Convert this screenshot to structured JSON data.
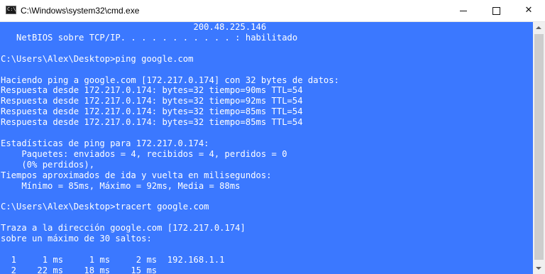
{
  "window": {
    "title": "C:\\Windows\\system32\\cmd.exe",
    "icon": "cmd-icon",
    "icon_prompt": "C:\\",
    "controls": {
      "minimize_icon": "minimize-icon",
      "maximize_icon": "maximize-icon",
      "close_label": "✕"
    }
  },
  "console": {
    "background": "#3b78ff",
    "text_color": "#ffffff",
    "lines": [
      "                                     200.48.225.146",
      "   NetBIOS sobre TCP/IP. . . . . . . . . . . : habilitado",
      "",
      "C:\\Users\\Alex\\Desktop>ping google.com",
      "",
      "Haciendo ping a google.com [172.217.0.174] con 32 bytes de datos:",
      "Respuesta desde 172.217.0.174: bytes=32 tiempo=90ms TTL=54",
      "Respuesta desde 172.217.0.174: bytes=32 tiempo=92ms TTL=54",
      "Respuesta desde 172.217.0.174: bytes=32 tiempo=85ms TTL=54",
      "Respuesta desde 172.217.0.174: bytes=32 tiempo=85ms TTL=54",
      "",
      "Estadísticas de ping para 172.217.0.174:",
      "    Paquetes: enviados = 4, recibidos = 4, perdidos = 0",
      "    (0% perdidos),",
      "Tiempos aproximados de ida y vuelta en milisegundos:",
      "    Mínimo = 85ms, Máximo = 92ms, Media = 88ms",
      "",
      "C:\\Users\\Alex\\Desktop>tracert google.com",
      "",
      "Traza a la dirección google.com [172.217.0.174]",
      "sobre un máximo de 30 saltos:",
      "",
      "  1     1 ms     1 ms     2 ms  192.168.1.1",
      "  2    22 ms    18 ms    15 ms"
    ]
  }
}
